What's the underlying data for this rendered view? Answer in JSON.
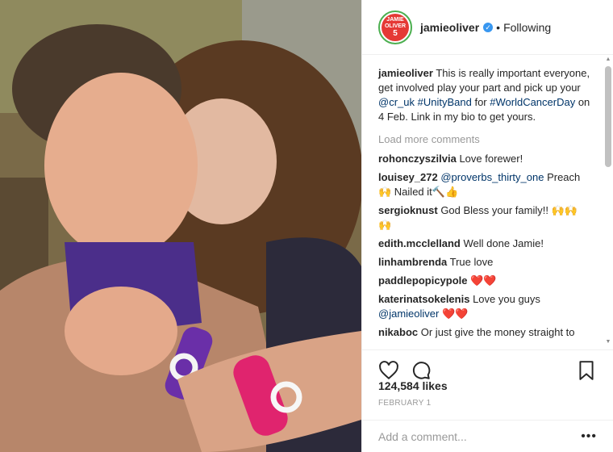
{
  "post": {
    "image_alt": "Selfie of two people wearing knotted Unity Band wristbands",
    "author": {
      "avatar_text": "JAMIE OLIVER",
      "avatar_number": "5",
      "handle": "jamieoliver",
      "verified_icon": "verified-badge-icon",
      "follow_status": "Following"
    },
    "caption": {
      "handle": "jamieoliver",
      "text_1": "This is really important everyone, get involved play your part and pick up your ",
      "mention": "@cr_uk",
      "text_2": " ",
      "hashtag_1": "#UnityBand",
      "text_3": " for ",
      "hashtag_2": "#WorldCancerDay",
      "text_4": " on 4 Feb. Link in my bio to get yours."
    },
    "load_more": "Load more comments",
    "comments": [
      {
        "user": "rohonczyszilvia",
        "text": "Love forewer!"
      },
      {
        "user": "louisey_272",
        "mention": "@proverbs_thirty_one",
        "text": "Preach 🙌 Nailed it🔨👍"
      },
      {
        "user": "sergioknust",
        "text": "God Bless your family!! 🙌🙌 🙌"
      },
      {
        "user": "edith.mcclelland",
        "text": "Well done Jamie!"
      },
      {
        "user": "linhambrenda",
        "text": "True love"
      },
      {
        "user": "paddlepopicypole",
        "text": "❤️❤️"
      },
      {
        "user": "katerinatsokelenis",
        "text": "Love you guys",
        "mention": "@jamieoliver",
        "tail": "❤️❤️"
      },
      {
        "user": "nikaboc",
        "text": "Or just give the money straight to"
      }
    ],
    "likes": "124,584 likes",
    "date": "FEBRUARY 1",
    "add_comment_placeholder": "Add a comment...",
    "more_icon": "ellipsis-icon",
    "colors": {
      "link": "#003569",
      "verified": "#3897f0",
      "heart": "#ed4956"
    }
  }
}
